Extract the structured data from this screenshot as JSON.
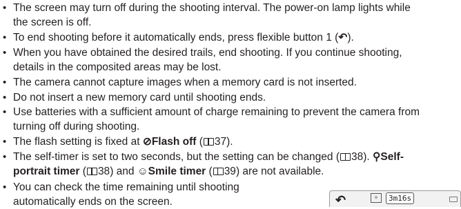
{
  "notes": [
    {
      "lines": [
        "The screen may turn off during the shooting interval. The power-on lamp lights while",
        "the screen is off."
      ]
    },
    {
      "prefix": "To end shooting before it automatically ends, press flexible button 1 (",
      "icon": "back-arrow-icon",
      "suffix": ")."
    },
    {
      "lines": [
        "When you have obtained the desired trails, end shooting. If you continue shooting,",
        "details in the composited areas may be lost."
      ]
    },
    {
      "lines": [
        "The camera cannot capture images when a memory card is not inserted."
      ]
    },
    {
      "lines": [
        "Do not insert a new memory card until shooting ends."
      ]
    },
    {
      "lines": [
        "Use batteries with a sufficient amount of charge remaining to prevent the camera from",
        "turning off during shooting."
      ]
    },
    {
      "prefix": "The flash setting is fixed at ",
      "icon": "flash-off-icon",
      "bold": "Flash off",
      "ref_open": " (",
      "ref_page": "37",
      "suffix": ")."
    },
    {
      "line1_prefix": "The self-timer is set to two seconds, but the setting can be changed (",
      "line1_page": "38",
      "line1_mid": "). ",
      "icon1": "self-portrait-icon",
      "bold1_a": "Self-",
      "bold1_b": "portrait timer",
      "line2_open": " (",
      "line2_page1": "38",
      "line2_and": ") and ",
      "icon2": "smile-timer-icon",
      "bold2": "Smile timer",
      "line2_open2": " (",
      "line2_page2": "39",
      "line2_suffix": ") are not available."
    },
    {
      "lines": [
        "You can check the time remaining until shooting",
        "automatically ends on the screen."
      ]
    }
  ],
  "screen_preview": {
    "timer": "3m16s",
    "back_icon": "back-arrow-icon",
    "mode_icon": "star-trails-mode-icon",
    "battery_icon": "battery-icon"
  }
}
